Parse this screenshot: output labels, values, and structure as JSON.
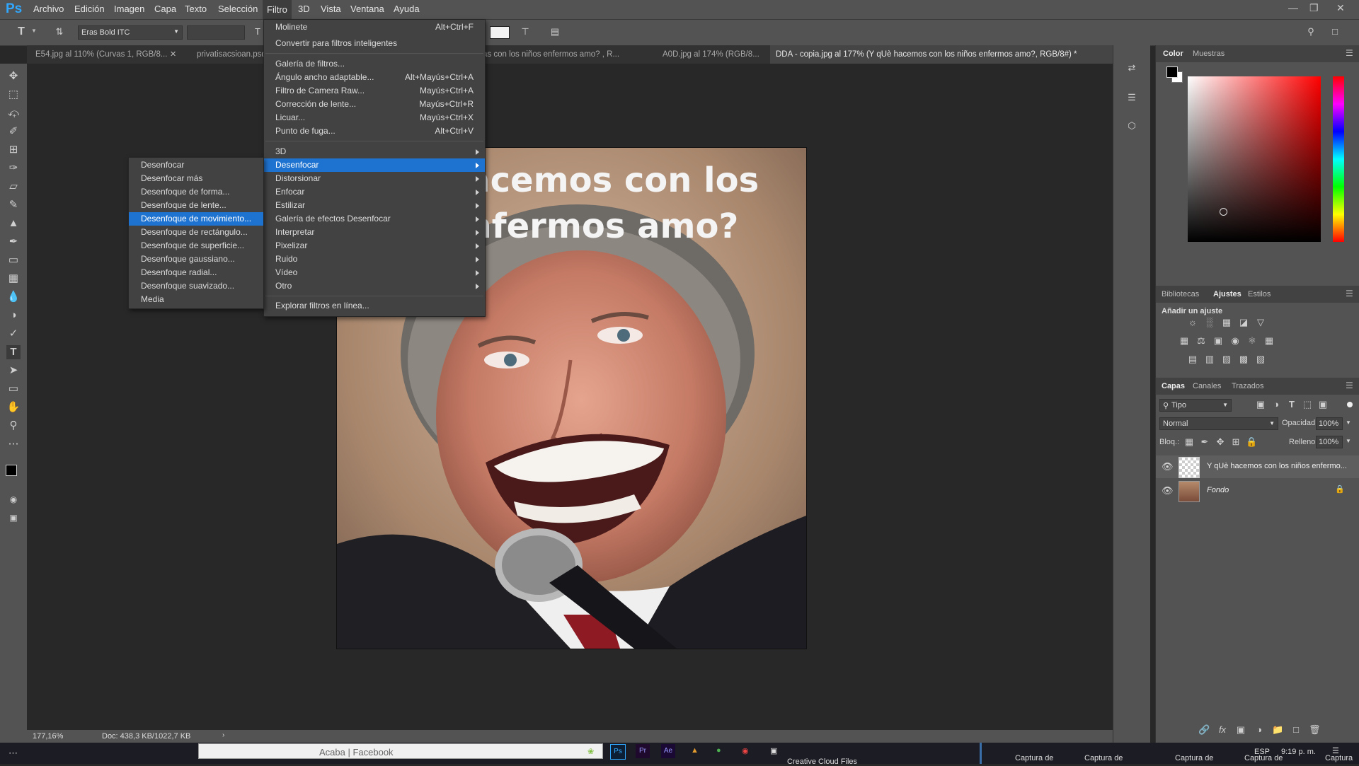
{
  "app": {
    "logo": "Ps"
  },
  "menubar": {
    "items": [
      "Archivo",
      "Edición",
      "Imagen",
      "Capa",
      "Texto",
      "Selección",
      "Filtro",
      "3D",
      "Vista",
      "Ventana",
      "Ayuda"
    ]
  },
  "options": {
    "font": "Eras Bold ITC"
  },
  "tabs": [
    {
      "label": "E54.jpg al 110% (Curvas 1, RGB/8..."
    },
    {
      "label": "privatisacsioan.psd"
    },
    {
      "label": "as con los niños enfermos  amo? , R..."
    },
    {
      "label": "A0D.jpg al 174% (RGB/8..."
    },
    {
      "label": "DDA - copia.jpg al 177% (Y qUè hacemos con los niños enfermos amo?, RGB/8#) *"
    }
  ],
  "canvas": {
    "text_line1": "hacemos con los",
    "text_line2": "enfermos amo?"
  },
  "filter_menu": {
    "items": [
      {
        "label": "Molinete",
        "shortcut": "Alt+Ctrl+F"
      },
      {
        "label": "Convertir para filtros inteligentes",
        "shortcut": ""
      },
      {
        "label": "Galería de filtros...",
        "shortcut": ""
      },
      {
        "label": "Ángulo ancho adaptable...",
        "shortcut": "Alt+Mayús+Ctrl+A"
      },
      {
        "label": "Filtro de Camera Raw...",
        "shortcut": "Mayús+Ctrl+A"
      },
      {
        "label": "Corrección de lente...",
        "shortcut": "Mayús+Ctrl+R"
      },
      {
        "label": "Licuar...",
        "shortcut": "Mayús+Ctrl+X"
      },
      {
        "label": "Punto de fuga...",
        "shortcut": "Alt+Ctrl+V"
      },
      {
        "label": "3D",
        "shortcut": ""
      },
      {
        "label": "Desenfocar",
        "shortcut": ""
      },
      {
        "label": "Distorsionar",
        "shortcut": ""
      },
      {
        "label": "Enfocar",
        "shortcut": ""
      },
      {
        "label": "Estilizar",
        "shortcut": ""
      },
      {
        "label": "Galería de efectos Desenfocar",
        "shortcut": ""
      },
      {
        "label": "Interpretar",
        "shortcut": ""
      },
      {
        "label": "Pixelizar",
        "shortcut": ""
      },
      {
        "label": "Ruido",
        "shortcut": ""
      },
      {
        "label": "Vídeo",
        "shortcut": ""
      },
      {
        "label": "Otro",
        "shortcut": ""
      },
      {
        "label": "Explorar filtros en línea...",
        "shortcut": ""
      }
    ]
  },
  "blur_submenu": {
    "items": [
      "Desenfocar",
      "Desenfocar más",
      "Desenfoque de forma...",
      "Desenfoque de lente...",
      "Desenfoque de movimiento...",
      "Desenfoque de rectángulo...",
      "Desenfoque de superficie...",
      "Desenfoque gaussiano...",
      "Desenfoque radial...",
      "Desenfoque suavizado...",
      "Media"
    ]
  },
  "panels": {
    "color_tabs": [
      "Color",
      "Muestras"
    ],
    "adjust_tabs": [
      "Bibliotecas",
      "Ajustes",
      "Estilos"
    ],
    "adjust_title": "Añadir un ajuste",
    "layer_tabs": [
      "Capas",
      "Canales",
      "Trazados"
    ],
    "filter_kind": "Tipo",
    "blend_mode": "Normal",
    "opacity_label": "Opacidad:",
    "opacity_value": "100%",
    "lock_label": "Bloq.:",
    "fill_label": "Relleno:",
    "fill_value": "100%",
    "layers": [
      {
        "name": "Y qUè hacemos con los niños enfermo..."
      },
      {
        "name": "Fondo"
      }
    ]
  },
  "status": {
    "zoom": "177,16%",
    "doc": "Doc: 438,3 KB/1022,7 KB"
  },
  "taskbar": {
    "browser_tab": "Acaba | Facebook",
    "cc_files": "Creative Cloud Files",
    "captures": [
      "Captura de",
      "Captura de",
      "Captura de",
      "Captura de",
      "Captura"
    ],
    "lang": "ESP",
    "time": "9:19 p. m."
  },
  "colors": {
    "accent": "#1f73d0",
    "ps_blue": "#31a8ff"
  }
}
